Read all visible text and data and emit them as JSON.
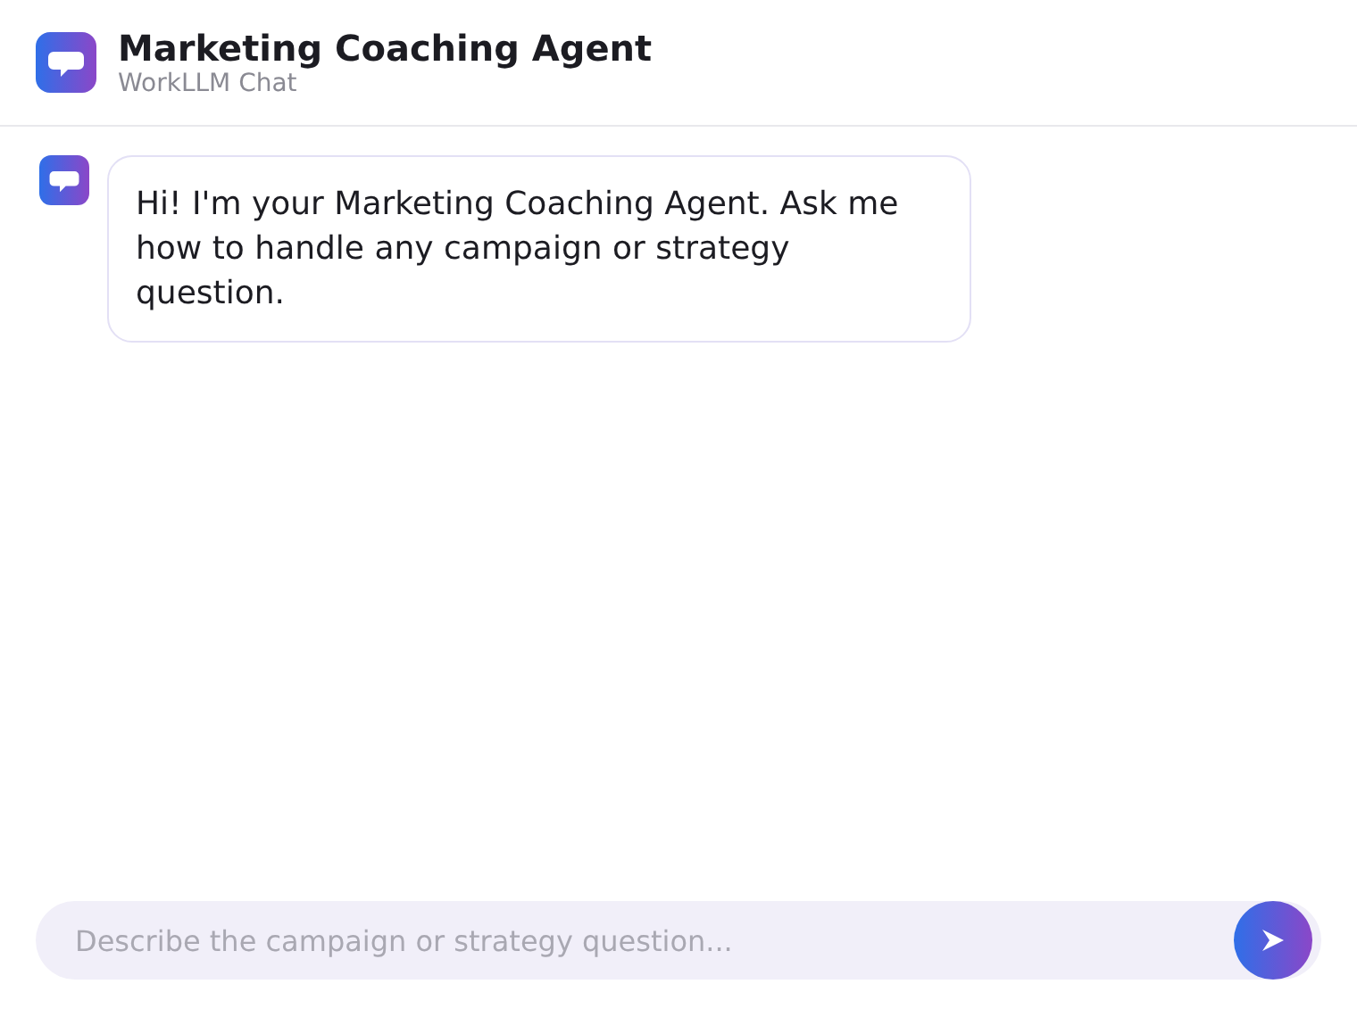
{
  "header": {
    "title": "Marketing Coaching Agent",
    "subtitle": "WorkLLM Chat"
  },
  "messages": [
    {
      "kind": "agent",
      "text": "Hi! I'm your Marketing Coaching Agent. Ask me how to handle any campaign or strategy question."
    }
  ],
  "composer": {
    "placeholder": "Describe the campaign or strategy question..."
  }
}
